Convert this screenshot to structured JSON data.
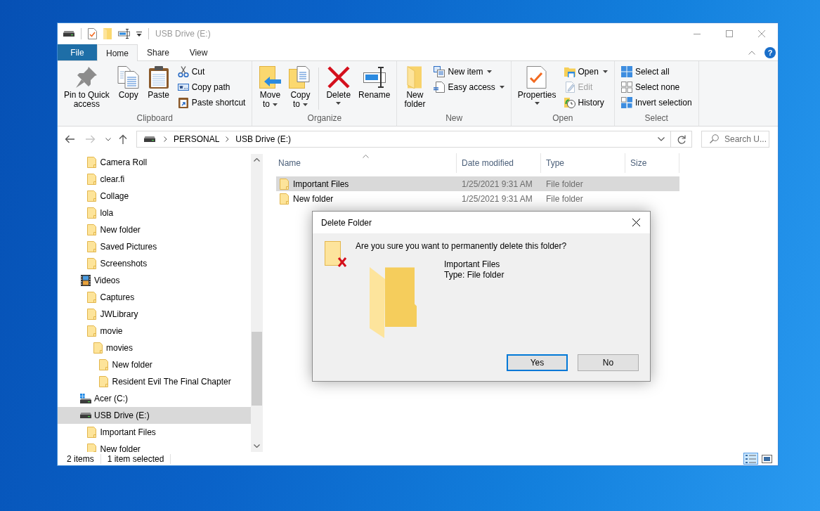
{
  "window": {
    "title": "USB Drive (E:)",
    "active": false
  },
  "ribbon": {
    "tabs": [
      {
        "label": "File",
        "kind": "file",
        "selected": false
      },
      {
        "label": "Home",
        "kind": "tab",
        "selected": true
      },
      {
        "label": "Share",
        "kind": "tab",
        "selected": false
      },
      {
        "label": "View",
        "kind": "tab",
        "selected": false
      }
    ],
    "help": "?",
    "groups": [
      {
        "label": "Clipboard",
        "items": [
          {
            "kind": "large",
            "label": "Pin to Quick\naccess",
            "dropdown": false
          },
          {
            "kind": "large",
            "label": "Copy",
            "dropdown": false
          },
          {
            "kind": "large",
            "label": "Paste",
            "dropdown": false
          },
          {
            "kind": "stack",
            "items": [
              {
                "label": "Cut",
                "dropdown": false,
                "disabled": false
              },
              {
                "label": "Copy path",
                "dropdown": false,
                "disabled": false
              },
              {
                "label": "Paste shortcut",
                "dropdown": false,
                "disabled": false
              }
            ]
          }
        ]
      },
      {
        "label": "Organize",
        "items": [
          {
            "kind": "large",
            "label": "Move\nto",
            "dropdown": true
          },
          {
            "kind": "large",
            "label": "Copy\nto",
            "dropdown": true
          },
          {
            "kind": "separator"
          },
          {
            "kind": "large",
            "label": "Delete",
            "dropdown": true
          },
          {
            "kind": "large",
            "label": "Rename",
            "dropdown": false
          }
        ]
      },
      {
        "label": "New",
        "items": [
          {
            "kind": "large",
            "label": "New\nfolder",
            "dropdown": false
          },
          {
            "kind": "stack",
            "items": [
              {
                "label": "New item",
                "dropdown": true,
                "disabled": false
              },
              {
                "label": "Easy access",
                "dropdown": true,
                "disabled": false
              }
            ]
          }
        ]
      },
      {
        "label": "Open",
        "items": [
          {
            "kind": "large",
            "label": "Properties",
            "dropdown": true
          },
          {
            "kind": "stack",
            "items": [
              {
                "label": "Open",
                "dropdown": true,
                "disabled": false
              },
              {
                "label": "Edit",
                "dropdown": false,
                "disabled": true
              },
              {
                "label": "History",
                "dropdown": false,
                "disabled": false
              }
            ]
          }
        ]
      },
      {
        "label": "Select",
        "items": [
          {
            "kind": "stack",
            "items": [
              {
                "label": "Select all",
                "dropdown": false,
                "disabled": false
              },
              {
                "label": "Select none",
                "dropdown": false,
                "disabled": false
              },
              {
                "label": "Invert selection",
                "dropdown": false,
                "disabled": false
              }
            ]
          }
        ]
      }
    ]
  },
  "address_bar": {
    "back": {
      "disabled": false
    },
    "forward": {
      "disabled": true
    },
    "path": [
      "PERSONAL",
      "USB Drive (E:)"
    ]
  },
  "search": {
    "placeholder": "Search U..."
  },
  "navigation_pane": {
    "items": [
      {
        "children": [
          {
            "label": "Camera Roll",
            "kind": "folder",
            "selected": false
          },
          {
            "label": "clear.fi",
            "kind": "folder",
            "selected": false
          },
          {
            "label": "Collage",
            "kind": "folder",
            "selected": false
          },
          {
            "label": "lola",
            "kind": "folder",
            "selected": false
          },
          {
            "label": "New folder",
            "kind": "folder",
            "selected": false
          },
          {
            "label": "Saved Pictures",
            "kind": "folder",
            "selected": false
          },
          {
            "label": "Screenshots",
            "kind": "folder",
            "selected": false
          }
        ]
      },
      {
        "label": "Videos",
        "kind": "videos",
        "selected": false,
        "children": [
          {
            "label": "Captures",
            "kind": "folder",
            "selected": false
          },
          {
            "label": "JWLibrary",
            "kind": "folder",
            "selected": false
          },
          {
            "label": "movie",
            "kind": "folder",
            "selected": false,
            "children": [
              {
                "label": "movies",
                "kind": "folder",
                "selected": false,
                "children": [
                  {
                    "label": "New folder",
                    "kind": "folder",
                    "selected": false
                  },
                  {
                    "label": "Resident Evil The Final Chapter",
                    "kind": "folder",
                    "selected": false
                  }
                ]
              }
            ]
          }
        ]
      },
      {
        "label": "Acer (C:)",
        "kind": "system_drive",
        "selected": false
      },
      {
        "label": "USB Drive (E:)",
        "kind": "usb_drive",
        "selected": true,
        "children": [
          {
            "label": "Important Files",
            "kind": "folder",
            "selected": false
          },
          {
            "label": "New folder",
            "kind": "folder",
            "selected": false
          }
        ]
      }
    ]
  },
  "file_list": {
    "columns": [
      {
        "label": "Name",
        "sorted": true
      },
      {
        "label": "Date modified",
        "sorted": false
      },
      {
        "label": "Type",
        "sorted": false
      },
      {
        "label": "Size",
        "sorted": false
      }
    ],
    "rows": [
      {
        "name": "Important Files",
        "date_modified": "1/25/2021 9:31 AM",
        "type": "File folder",
        "selected": true
      },
      {
        "name": "New folder",
        "date_modified": "1/25/2021 9:31 AM",
        "type": "File folder",
        "selected": false
      }
    ]
  },
  "status_bar": {
    "item_count": "2 items",
    "selection": "1 item selected",
    "views": [
      {
        "kind": "details",
        "selected": true
      },
      {
        "kind": "large_icons",
        "selected": false
      }
    ]
  },
  "dialog": {
    "title": "Delete Folder",
    "message": "Are you sure you want to permanently delete this folder?",
    "item_name": "Important Files",
    "item_type": "Type: File folder",
    "buttons": [
      {
        "label": "Yes",
        "focused": true
      },
      {
        "label": "No",
        "focused": false
      }
    ]
  }
}
